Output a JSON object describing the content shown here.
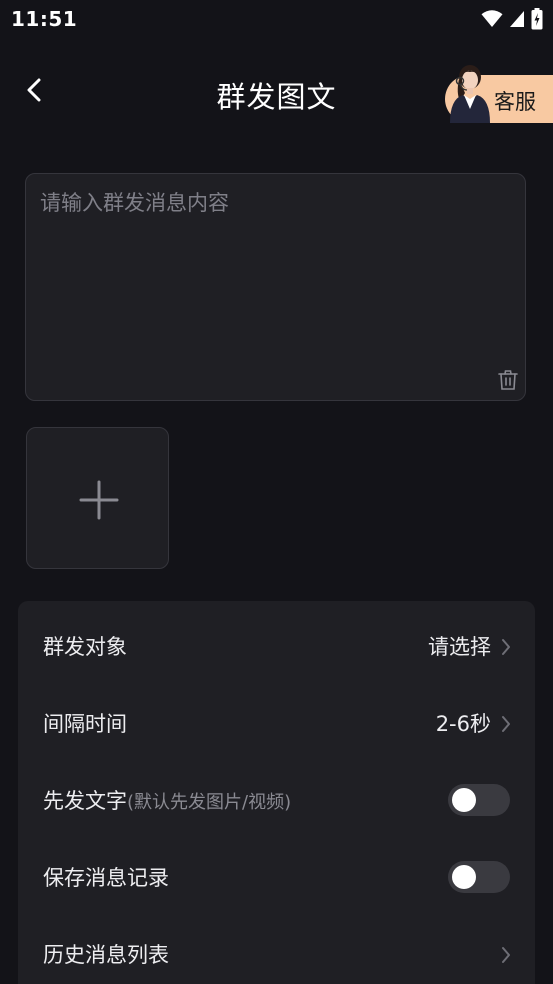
{
  "status_bar": {
    "time": "11:51"
  },
  "header": {
    "title": "群发图文",
    "service_label": "客服"
  },
  "message": {
    "placeholder": "请输入群发消息内容",
    "value": ""
  },
  "settings": {
    "target": {
      "label": "群发对象",
      "value": "请选择"
    },
    "interval": {
      "label": "间隔时间",
      "value": "2-6秒"
    },
    "text_first": {
      "label": "先发文字",
      "hint": "(默认先发图片/视频)",
      "enabled": false
    },
    "save_record": {
      "label": "保存消息记录",
      "enabled": false
    },
    "history": {
      "label": "历史消息列表"
    }
  },
  "colors": {
    "background": "#131318",
    "card": "#1f1f24",
    "service_button": "#f8c9a2",
    "toggle_off": "#3a3a40"
  },
  "icons": [
    "wifi-icon",
    "signal-icon",
    "battery-charging-icon",
    "back-arrow-icon",
    "agent-avatar",
    "trash-icon",
    "plus-icon",
    "chevron-right-icon"
  ]
}
